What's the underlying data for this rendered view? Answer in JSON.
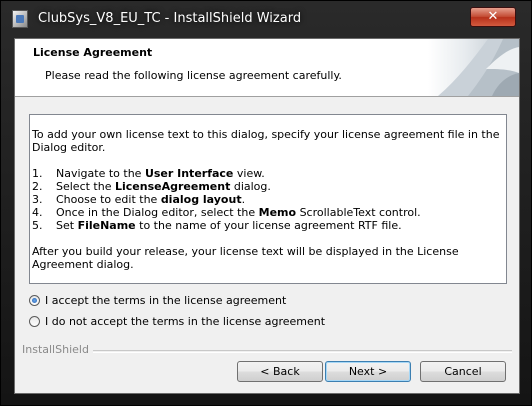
{
  "window": {
    "title": "ClubSys_V8_EU_TC - InstallShield Wizard",
    "close_label": "✕"
  },
  "header": {
    "title": "License Agreement",
    "subtitle": "Please read the following license agreement carefully."
  },
  "license": {
    "intro": "To add your own license text to this dialog, specify your license agreement file in the Dialog editor.",
    "steps": [
      {
        "num": "1.",
        "pre": "Navigate to the ",
        "bold": "User Interface",
        "post": " view."
      },
      {
        "num": "2.",
        "pre": "Select the ",
        "bold": "LicenseAgreement",
        "post": " dialog."
      },
      {
        "num": "3.",
        "pre": "Choose to edit the ",
        "bold": "dialog layout",
        "post": "."
      },
      {
        "num": "4.",
        "pre": "Once in the Dialog editor, select the ",
        "bold": "Memo",
        "post": " ScrollableText control."
      },
      {
        "num": "5.",
        "pre": "Set ",
        "bold": "FileName",
        "post": " to the name of your license agreement RTF file."
      }
    ],
    "outro": "After you build your release, your license text will be displayed in the License Agreement dialog."
  },
  "options": {
    "accept_label": "I accept the terms in the license agreement",
    "decline_label": "I do not accept the terms in the license agreement",
    "selected": "accept"
  },
  "footer": {
    "brand": "InstallShield",
    "back_label": "< Back",
    "next_label": "Next >",
    "cancel_label": "Cancel"
  }
}
